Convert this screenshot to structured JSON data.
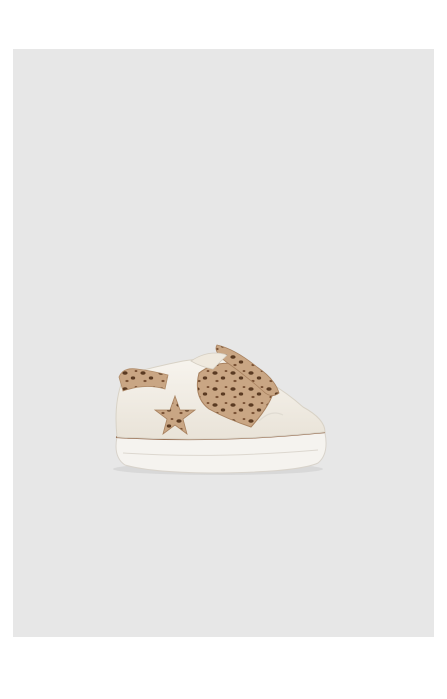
{
  "page": {
    "background_color": "#ffffff"
  },
  "product_image": {
    "frame_color": "#e7e7e7",
    "subject": "baby sneaker",
    "colors": {
      "upper": "#f2eee6",
      "sole": "#f5f3ef",
      "leopard_base": "#c9a684",
      "leopard_spot": "#5a3a22",
      "piping": "#8a5a3a"
    }
  }
}
